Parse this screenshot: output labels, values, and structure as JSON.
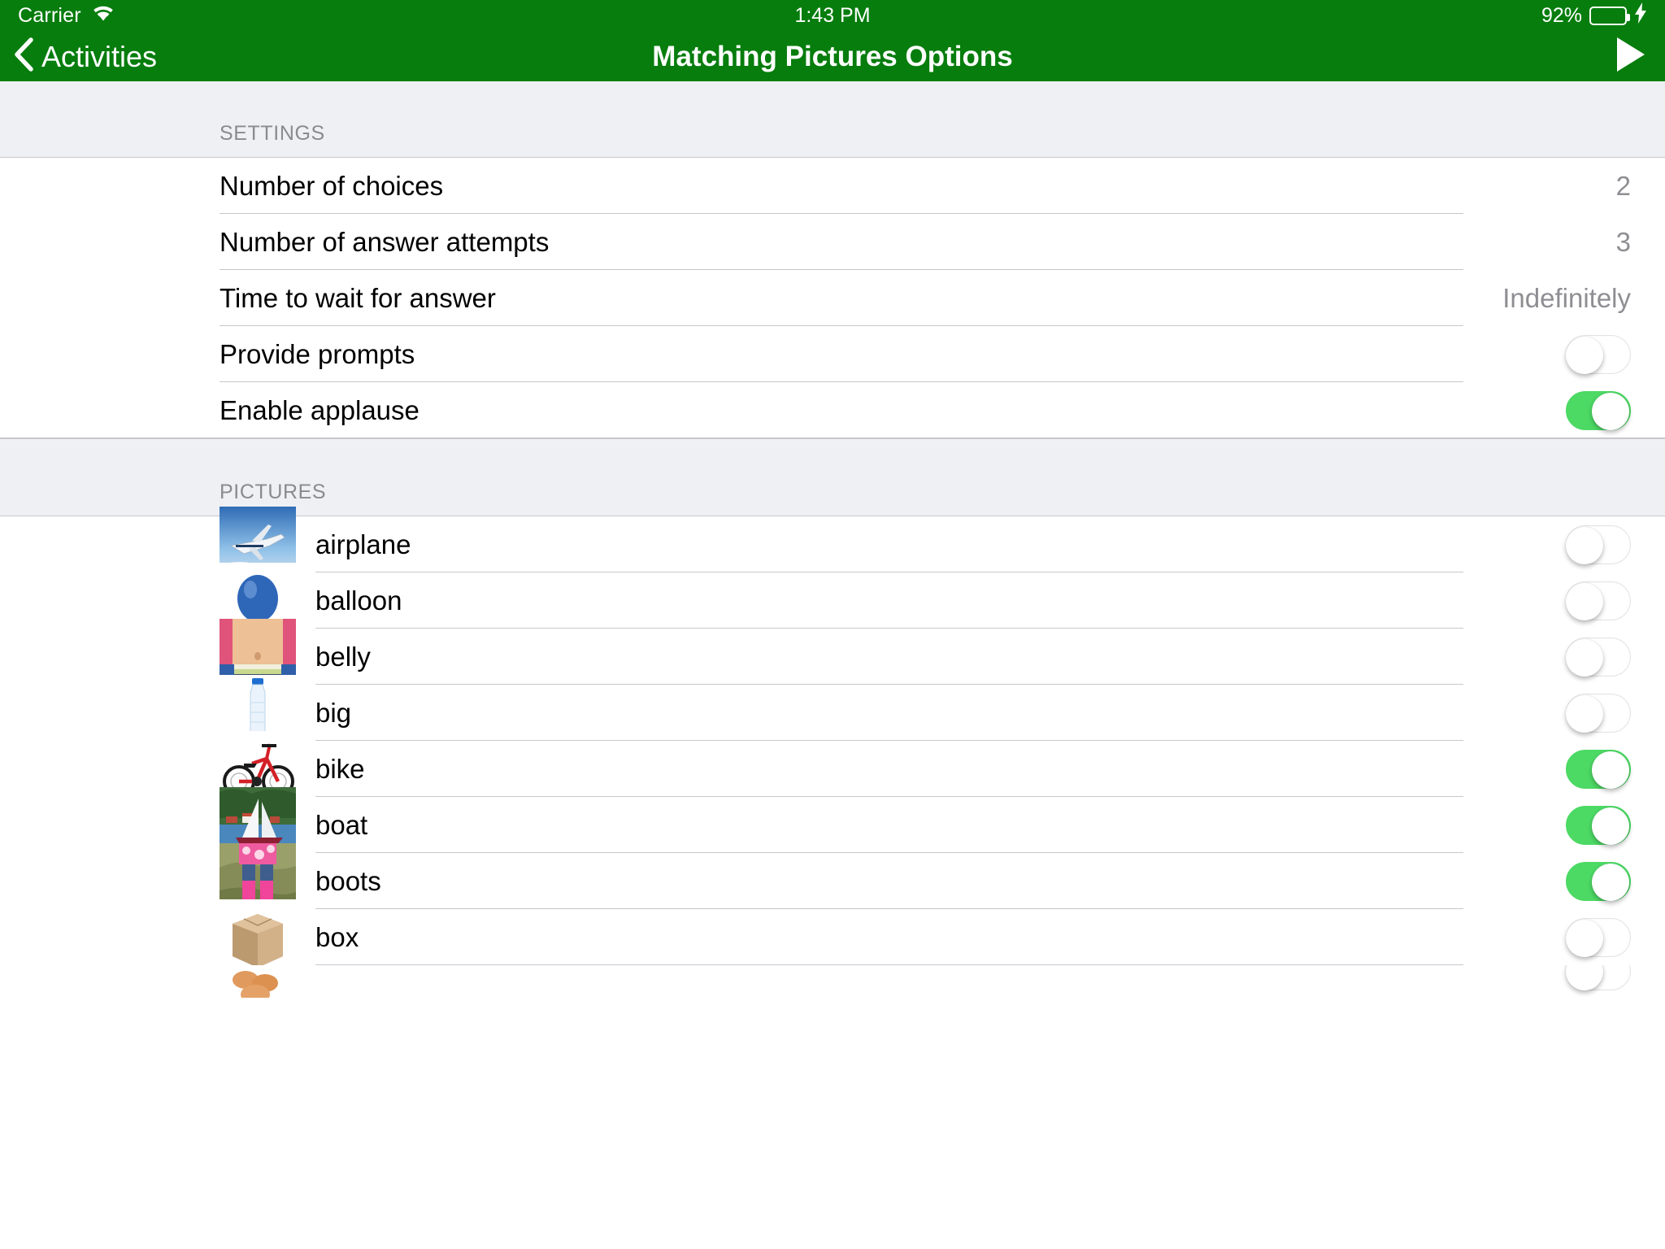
{
  "status_bar": {
    "carrier": "Carrier",
    "wifi_icon": "wifi-icon",
    "time": "1:43 PM",
    "battery_percent": "92%",
    "battery_level": 92,
    "charging_icon": "lightning-bolt-icon"
  },
  "nav_bar": {
    "back_icon": "chevron-left-icon",
    "back_label": "Activities",
    "title": "Matching Pictures Options",
    "play_icon": "play-icon",
    "background_color": "#067d0d"
  },
  "sections": [
    {
      "header": "SETTINGS",
      "rows": [
        {
          "label": "Number of choices",
          "type": "value",
          "value": "2"
        },
        {
          "label": "Number of answer attempts",
          "type": "value",
          "value": "3"
        },
        {
          "label": "Time to wait for answer",
          "type": "value",
          "value": "Indefinitely"
        },
        {
          "label": "Provide prompts",
          "type": "switch",
          "on": false
        },
        {
          "label": "Enable applause",
          "type": "switch",
          "on": true
        }
      ]
    },
    {
      "header": "PICTURES",
      "rows": [
        {
          "label": "airplane",
          "type": "switch",
          "on": false,
          "thumb": "airplane-thumbnail"
        },
        {
          "label": "balloon",
          "type": "switch",
          "on": false,
          "thumb": "balloon-thumbnail"
        },
        {
          "label": "belly",
          "type": "switch",
          "on": false,
          "thumb": "belly-thumbnail"
        },
        {
          "label": "big",
          "type": "switch",
          "on": false,
          "thumb": "big-water-bottle-thumbnail"
        },
        {
          "label": "bike",
          "type": "switch",
          "on": true,
          "thumb": "bike-thumbnail"
        },
        {
          "label": "boat",
          "type": "switch",
          "on": true,
          "thumb": "boat-thumbnail"
        },
        {
          "label": "boots",
          "type": "switch",
          "on": true,
          "thumb": "boots-thumbnail"
        },
        {
          "label": "box",
          "type": "switch",
          "on": false,
          "thumb": "box-thumbnail"
        },
        {
          "label": "",
          "type": "switch",
          "on": false,
          "thumb": "partial-thumbnail"
        }
      ]
    }
  ],
  "colors": {
    "accent_green": "#067d0d",
    "switch_on": "#4cd964",
    "separator": "#c8c7cc",
    "section_bg": "#eff0f4",
    "secondary_text": "#8e8e93"
  }
}
